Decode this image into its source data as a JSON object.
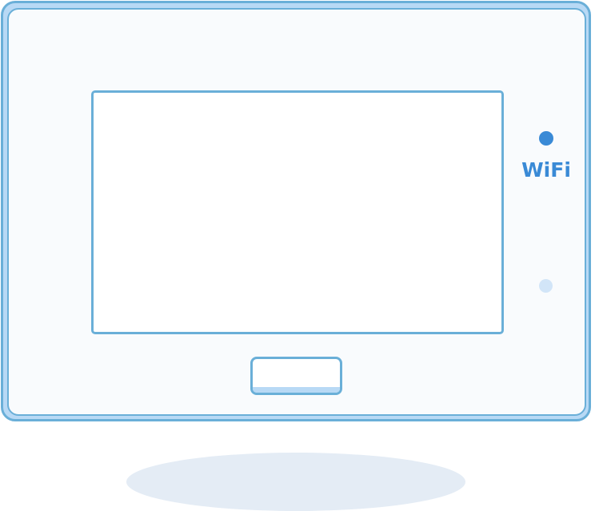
{
  "device": {
    "indicator_label": "WiFi",
    "wifi_led": "on",
    "secondary_led": "off"
  },
  "colors": {
    "frame_stroke": "#6aafd8",
    "frame_fill": "#b8d9f5",
    "panel_fill": "#f9fbfd",
    "screen_fill": "#ffffff",
    "wifi_led_on": "#3a8ad6",
    "led_off": "#d2e5f8",
    "label": "#3a8ad6",
    "shadow": "#e4ecf5"
  }
}
